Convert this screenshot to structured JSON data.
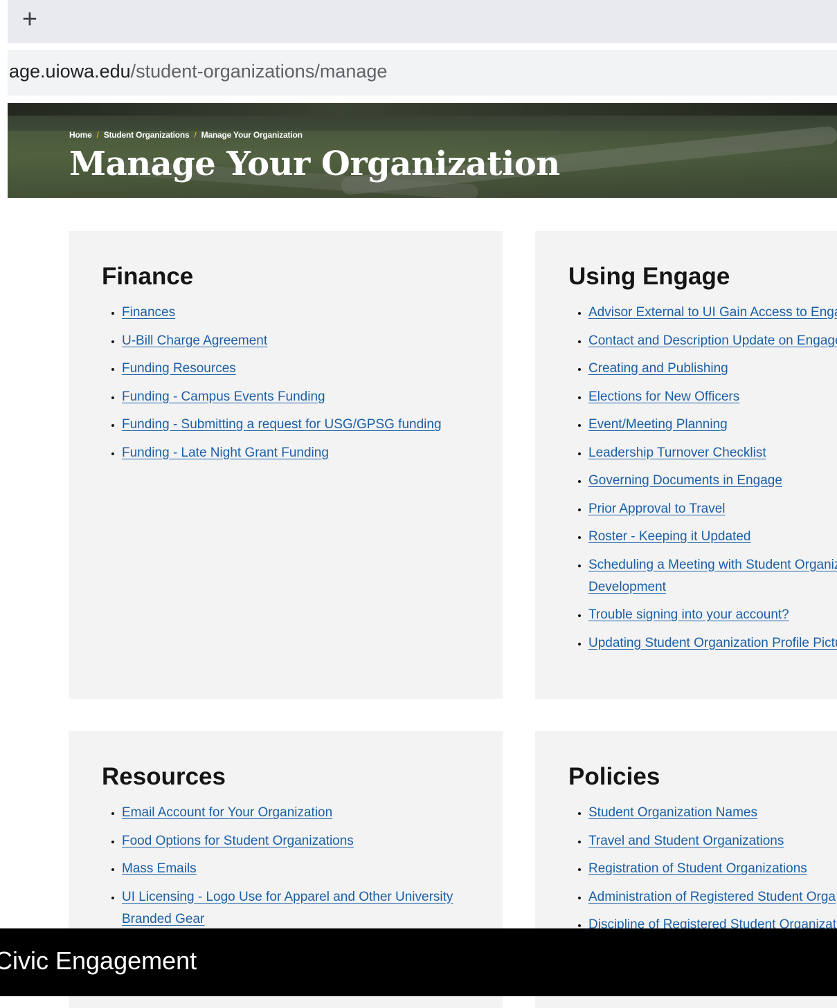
{
  "browser": {
    "new_tab_icon": "+",
    "url_host": "age.uiowa.edu",
    "url_path": "/student-organizations/manage"
  },
  "hero": {
    "breadcrumb": [
      "Home",
      "Student Organizations",
      "Manage Your Organization"
    ],
    "separator": "/",
    "title": "Manage Your Organization"
  },
  "cards": {
    "finance": {
      "title": "Finance",
      "links": [
        "Finances",
        "U-Bill Charge Agreement",
        "Funding Resources",
        "Funding - Campus Events Funding",
        "Funding - Submitting a request for USG/GPSG funding",
        "Funding - Late Night Grant Funding"
      ]
    },
    "using_engage": {
      "title": "Using Engage",
      "links": [
        "Advisor External to UI Gain Access to Enga",
        "Contact and Description Update on Engage",
        "Creating and Publishing",
        "Elections for New Officers",
        "Event/Meeting Planning",
        "Leadership Turnover Checklist",
        "Governing Documents in Engage",
        "Prior Approval to Travel",
        "Roster - Keeping it Updated",
        "Scheduling a Meeting with Student Organiz Development",
        "Trouble signing into your account?",
        "Updating Student Organization Profile Pictu"
      ]
    },
    "resources": {
      "title": "Resources",
      "links": [
        "Email Account for Your Organization",
        "Food Options for Student Organizations",
        "Mass Emails",
        "UI Licensing - Logo Use for Apparel and Other University Branded Gear"
      ]
    },
    "policies": {
      "title": "Policies",
      "links": [
        "Student Organization Names",
        "Travel and Student Organizations",
        "Registration of Student Organizations",
        "Administration of Registered Student Orga",
        "Discipline of Registered Student Organizati"
      ]
    }
  },
  "footer": {
    "text": "Civic Engagement"
  }
}
